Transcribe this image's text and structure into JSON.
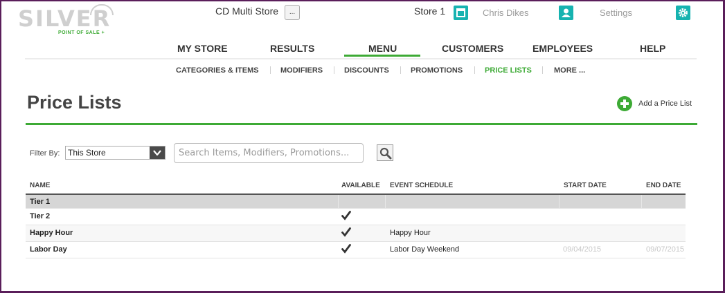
{
  "logo": {
    "word": "SILVER",
    "sub": "POINT OF SALE +"
  },
  "topbar": {
    "store_name": "CD Multi Store",
    "store_button": "...",
    "store_label": "Store 1",
    "user_name": "Chris Dikes",
    "settings_label": "Settings"
  },
  "main_nav": [
    {
      "label": "MY STORE"
    },
    {
      "label": "RESULTS"
    },
    {
      "label": "MENU",
      "active": true
    },
    {
      "label": "CUSTOMERS"
    },
    {
      "label": "EMPLOYEES"
    },
    {
      "label": "HELP"
    }
  ],
  "sub_nav": [
    {
      "label": "CATEGORIES & ITEMS"
    },
    {
      "label": "MODIFIERS"
    },
    {
      "label": "DISCOUNTS"
    },
    {
      "label": "PROMOTIONS"
    },
    {
      "label": "PRICE LISTS",
      "active": true
    },
    {
      "label": "MORE ..."
    }
  ],
  "page": {
    "title": "Price Lists",
    "add_label": "Add a Price List"
  },
  "filter": {
    "label": "Filter By:",
    "selected": "This Store",
    "search_placeholder": "Search Items, Modifiers, Promotions..."
  },
  "table": {
    "headers": {
      "name": "NAME",
      "available": "AVAILABLE",
      "schedule": "EVENT SCHEDULE",
      "start": "START DATE",
      "end": "END DATE"
    },
    "rows": [
      {
        "name": "Tier 1",
        "available": false,
        "schedule": "",
        "start": "",
        "end": ""
      },
      {
        "name": "Tier 2",
        "available": true,
        "schedule": "",
        "start": "",
        "end": ""
      },
      {
        "name": "Happy Hour",
        "available": true,
        "schedule": "Happy Hour",
        "start": "",
        "end": ""
      },
      {
        "name": "Labor Day",
        "available": true,
        "schedule": "Labor Day Weekend",
        "start": "09/04/2015",
        "end": "09/07/2015"
      }
    ]
  },
  "colors": {
    "accent": "#3daa35",
    "icon_teal": "#16b3b0",
    "frame": "#5a1e5a"
  }
}
